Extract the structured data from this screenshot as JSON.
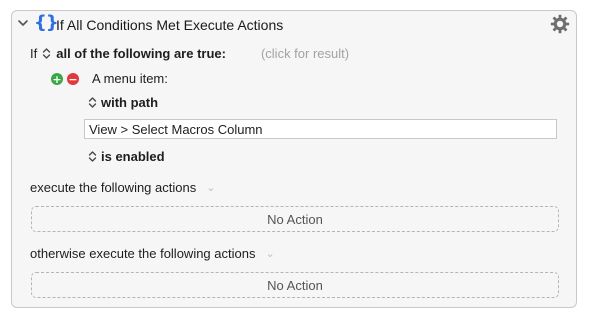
{
  "action": {
    "title": "If All Conditions Met Execute Actions",
    "braces_icon": "{}",
    "gear_icon": "gear-icon"
  },
  "condition": {
    "if_label": "If",
    "mode": "all of the following are true:",
    "result_hint": "(click for result)",
    "item_label": "A menu item:",
    "match_popup": "with path",
    "path_value": "View > Select Macros Column",
    "state_popup": "is enabled"
  },
  "execute": {
    "label": "execute the following actions",
    "empty": "No Action"
  },
  "otherwise": {
    "label": "otherwise execute the following actions",
    "empty": "No Action"
  },
  "colors": {
    "accent": "#2f6fe0",
    "add": "#3aa745",
    "remove": "#e0383b"
  }
}
